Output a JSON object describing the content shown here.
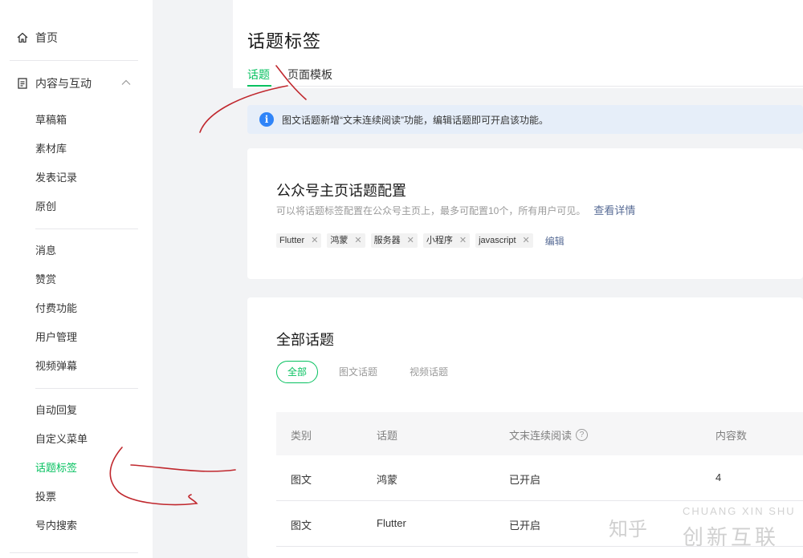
{
  "sidebar": {
    "home": "首页",
    "group": "内容与互动",
    "items": [
      "草稿箱",
      "素材库",
      "发表记录",
      "原创",
      "消息",
      "赞赏",
      "付费功能",
      "用户管理",
      "视频弹幕",
      "自动回复",
      "自定义菜单",
      "话题标签",
      "投票",
      "号内搜索"
    ],
    "active_item": "话题标签"
  },
  "header": {
    "title": "话题标签",
    "tabs": [
      {
        "label": "话题",
        "active": true
      },
      {
        "label": "页面模板",
        "active": false
      }
    ]
  },
  "notice": {
    "icon": "info-icon",
    "text": "图文话题新增“文末连续阅读”功能，编辑话题即可开启该功能。"
  },
  "homepage_config": {
    "title": "公众号主页话题配置",
    "subtitle": "可以将话题标签配置在公众号主页上，最多可配置10个，所有用户可见。",
    "detail_link": "查看详情",
    "tags": [
      "Flutter",
      "鸿蒙",
      "服务器",
      "小程序",
      "javascript"
    ],
    "edit_label": "编辑"
  },
  "all_topics": {
    "title": "全部话题",
    "filters": [
      {
        "label": "全部",
        "active": true
      },
      {
        "label": "图文话题",
        "active": false
      },
      {
        "label": "视频话题",
        "active": false
      }
    ],
    "columns": [
      "类别",
      "话题",
      "文末连续阅读",
      "内容数"
    ],
    "help_icon": "?",
    "rows": [
      [
        "图文",
        "鸿蒙",
        "已开启",
        "4"
      ],
      [
        "图文",
        "Flutter",
        "已开启",
        ""
      ]
    ]
  },
  "watermark": {
    "text": "知乎",
    "top": "CHUANG XIN SHU",
    "logo": "创新互联"
  },
  "colors": {
    "accent": "#07c160",
    "link": "#576b95",
    "info": "#2f84f8",
    "annotation": "#c0272d"
  }
}
